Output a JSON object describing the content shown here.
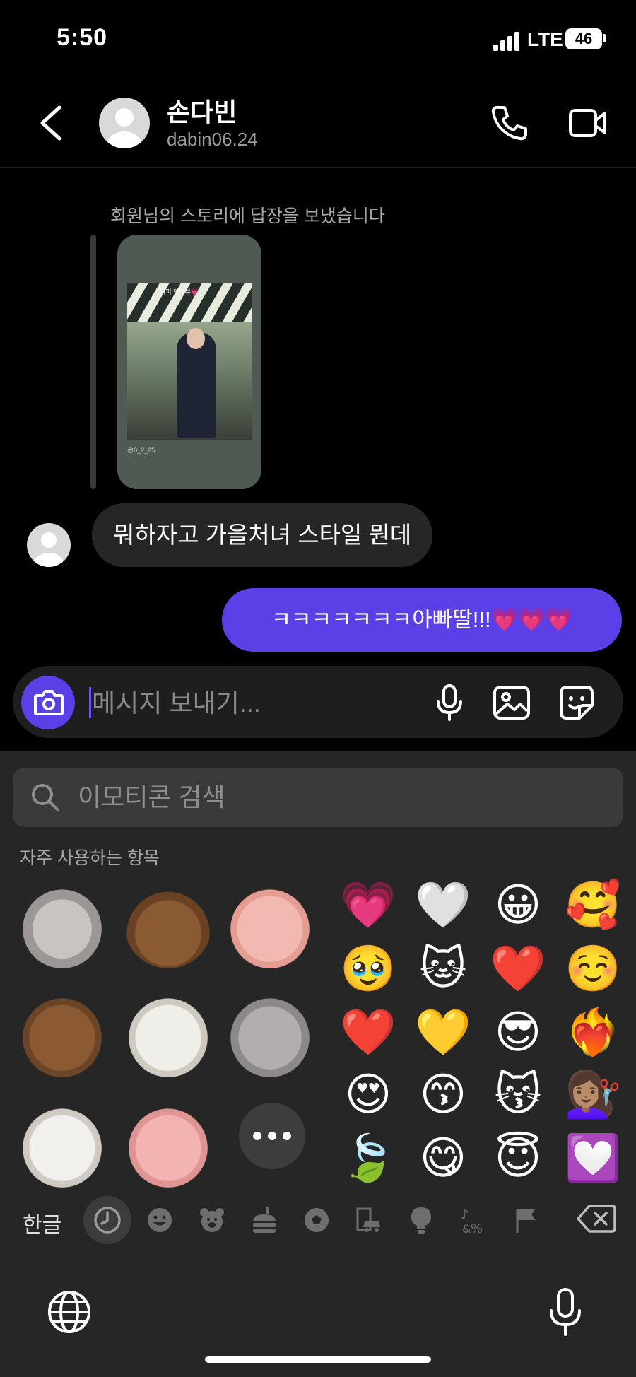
{
  "status_bar": {
    "time": "5:50",
    "network": "LTE",
    "battery": "46"
  },
  "header": {
    "name": "손다빈",
    "username": "dabin06.24"
  },
  "chat": {
    "partial_previous_text": "...",
    "story_reply_caption": "회원님의 스토리에 답장을 보냈습니다",
    "story_overlay_text": "커피 인터뷰💗",
    "story_tag": "@0_2_25",
    "incoming_message": "뭐하자고 가을처녀 스타일 뭔데",
    "outgoing_message": "ㅋㅋㅋㅋㅋㅋㅋ아빠딸!!!💗💗💗"
  },
  "composer": {
    "placeholder": "메시지 보내기..."
  },
  "keyboard": {
    "search_placeholder": "이모티콘 검색",
    "section_label": "자주 사용하는 항목",
    "emoji_grid": [
      "💗",
      "🤍",
      "😀",
      "🥰",
      "🥹",
      "🐱",
      "❤️",
      "☺️",
      "❤️",
      "💛",
      "😎",
      "❤️‍🔥",
      "😍",
      "😙",
      "😽",
      "💇🏽‍♀️",
      "🍃",
      "😋",
      "😇",
      "💟"
    ],
    "lang_label": "한글",
    "categories": [
      "recent-clock",
      "smileys",
      "animals",
      "food",
      "activity",
      "travel",
      "objects",
      "symbols",
      "flags"
    ]
  },
  "colors": {
    "accent": "#5b40e8",
    "bubble_in": "#262626",
    "keyboard_bg": "#262626"
  }
}
